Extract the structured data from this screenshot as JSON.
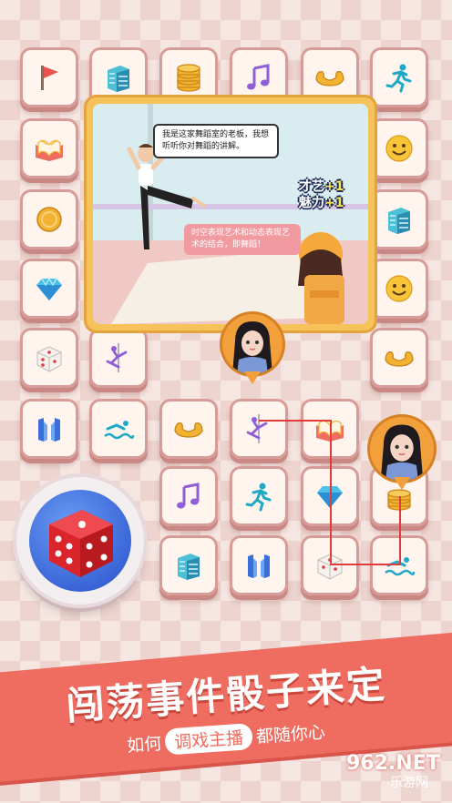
{
  "story": {
    "speech": "我是这家舞蹈室的老板，我想听听你对舞蹈的讲解。",
    "reply": "时空表现艺术和动态表现艺术的结合，即舞蹈！",
    "stat1": {
      "label": "才艺",
      "delta": "+1"
    },
    "stat2": {
      "label": "魅力",
      "delta": "+1"
    }
  },
  "banner": {
    "headline": "闯荡事件骰子来定",
    "sub_before": "如何",
    "sub_highlight": "调戏主播",
    "sub_after": "都随你心"
  },
  "watermark": {
    "brand": "962.NET",
    "site": "乐游网"
  },
  "colors": {
    "accent": "#ee6d60",
    "tile": "#fff4ee",
    "panel": "#f6c35a",
    "dice": "#3b66d8"
  },
  "tiles": [
    {
      "icon": "flag-icon"
    },
    {
      "icon": "buildings-icon"
    },
    {
      "icon": "coin-stack-icon"
    },
    {
      "icon": "music-note-icon"
    },
    {
      "icon": "muscle-icon"
    },
    {
      "icon": "runner-icon"
    },
    {
      "icon": "book-icon"
    },
    {
      "icon": "smiley-icon"
    },
    {
      "icon": "coin-icon"
    },
    {
      "icon": "buildings-icon"
    },
    {
      "icon": "diamond-icon"
    },
    {
      "icon": "smiley-icon"
    },
    {
      "icon": "dice-icon"
    },
    {
      "icon": "pole-dance-icon"
    },
    {
      "icon": "muscle-icon"
    },
    {
      "icon": "gate-icon"
    },
    {
      "icon": "swimmer-icon"
    },
    {
      "icon": "muscle-icon"
    },
    {
      "icon": "pole-dance-icon"
    },
    {
      "icon": "book-icon"
    },
    {
      "icon": "music-note-icon"
    },
    {
      "icon": "runner-icon"
    },
    {
      "icon": "diamond-icon"
    },
    {
      "icon": "buildings-icon"
    },
    {
      "icon": "gate-icon"
    },
    {
      "icon": "dice-icon"
    },
    {
      "icon": "swimmer-icon"
    }
  ]
}
